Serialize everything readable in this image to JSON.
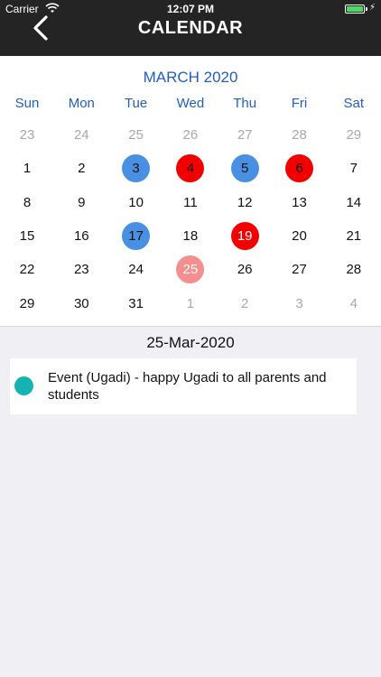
{
  "status_bar": {
    "carrier": "Carrier",
    "time": "12:07 PM"
  },
  "header": {
    "title": "CALENDAR",
    "back_icon": "chevron-left-icon"
  },
  "calendar": {
    "month_label": "MARCH 2020",
    "weekdays": [
      "Sun",
      "Mon",
      "Tue",
      "Wed",
      "Thu",
      "Fri",
      "Sat"
    ],
    "weeks": [
      [
        {
          "d": "23",
          "t": "out"
        },
        {
          "d": "24",
          "t": "out"
        },
        {
          "d": "25",
          "t": "out"
        },
        {
          "d": "26",
          "t": "out"
        },
        {
          "d": "27",
          "t": "out"
        },
        {
          "d": "28",
          "t": "out"
        },
        {
          "d": "29",
          "t": "out"
        }
      ],
      [
        {
          "d": "1"
        },
        {
          "d": "2"
        },
        {
          "d": "3",
          "t": "blue"
        },
        {
          "d": "4",
          "t": "red"
        },
        {
          "d": "5",
          "t": "blue"
        },
        {
          "d": "6",
          "t": "red"
        },
        {
          "d": "7"
        }
      ],
      [
        {
          "d": "8"
        },
        {
          "d": "9"
        },
        {
          "d": "10"
        },
        {
          "d": "11"
        },
        {
          "d": "12"
        },
        {
          "d": "13"
        },
        {
          "d": "14"
        }
      ],
      [
        {
          "d": "15"
        },
        {
          "d": "16"
        },
        {
          "d": "17",
          "t": "blue"
        },
        {
          "d": "18"
        },
        {
          "d": "19",
          "t": "red",
          "white": true
        },
        {
          "d": "20"
        },
        {
          "d": "21"
        }
      ],
      [
        {
          "d": "22"
        },
        {
          "d": "23"
        },
        {
          "d": "24"
        },
        {
          "d": "25",
          "t": "pink"
        },
        {
          "d": "26"
        },
        {
          "d": "27"
        },
        {
          "d": "28"
        }
      ],
      [
        {
          "d": "29"
        },
        {
          "d": "30"
        },
        {
          "d": "31"
        },
        {
          "d": "1",
          "t": "out"
        },
        {
          "d": "2",
          "t": "out"
        },
        {
          "d": "3",
          "t": "out"
        },
        {
          "d": "4",
          "t": "out"
        }
      ]
    ],
    "colors": {
      "event_blue": "#4a90e2",
      "holiday_red": "#f20000",
      "selected_pink": "#f58e8e",
      "accent": "#1f5fbf"
    }
  },
  "selected_date": "25-Mar-2020",
  "events": [
    {
      "text": "Event (Ugadi) - happy Ugadi to all parents and students",
      "dot_color": "#16b3b3"
    }
  ]
}
